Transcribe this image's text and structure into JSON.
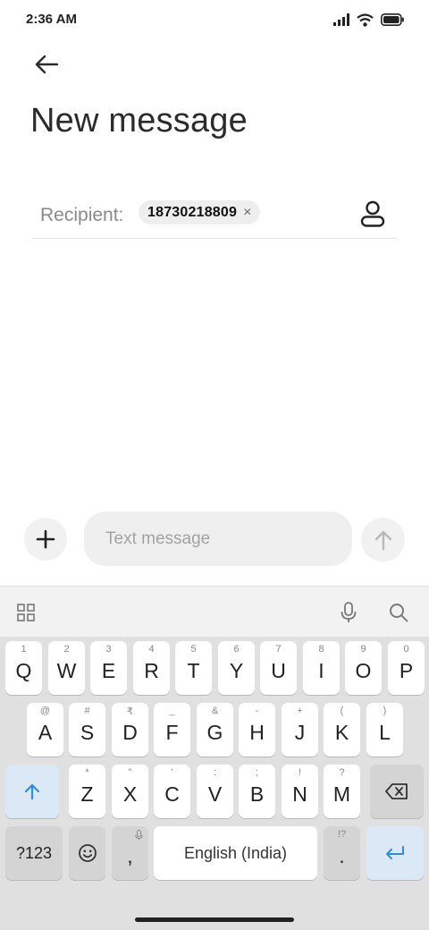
{
  "status_bar": {
    "time": "2:36 AM",
    "icons": [
      "signal-icon",
      "wifi-icon",
      "battery-icon"
    ]
  },
  "header": {
    "back_icon": "arrow-left-icon",
    "title": "New message"
  },
  "recipient": {
    "label": "Recipient:",
    "chips": [
      {
        "number": "18730218809",
        "remove_symbol": "×"
      }
    ],
    "contact_icon": "person-icon"
  },
  "compose": {
    "attach_icon": "plus-icon",
    "placeholder": "Text message",
    "value": "",
    "send_icon": "arrow-up-icon"
  },
  "keyboard": {
    "toolbar": {
      "left_icon": "grid-icon",
      "mic_icon": "microphone-icon",
      "search_icon": "search-icon"
    },
    "row1": [
      {
        "key": "Q",
        "hint": "1"
      },
      {
        "key": "W",
        "hint": "2"
      },
      {
        "key": "E",
        "hint": "3"
      },
      {
        "key": "R",
        "hint": "4"
      },
      {
        "key": "T",
        "hint": "5"
      },
      {
        "key": "Y",
        "hint": "6"
      },
      {
        "key": "U",
        "hint": "7"
      },
      {
        "key": "I",
        "hint": "8"
      },
      {
        "key": "O",
        "hint": "9"
      },
      {
        "key": "P",
        "hint": "0"
      }
    ],
    "row2": [
      {
        "key": "A",
        "hint": "@"
      },
      {
        "key": "S",
        "hint": "#"
      },
      {
        "key": "D",
        "hint": "₹"
      },
      {
        "key": "F",
        "hint": "_"
      },
      {
        "key": "G",
        "hint": "&"
      },
      {
        "key": "H",
        "hint": "-"
      },
      {
        "key": "J",
        "hint": "+"
      },
      {
        "key": "K",
        "hint": "("
      },
      {
        "key": "L",
        "hint": ")"
      }
    ],
    "row3": [
      {
        "key": "Z",
        "hint": "*"
      },
      {
        "key": "X",
        "hint": "\""
      },
      {
        "key": "C",
        "hint": "'"
      },
      {
        "key": "V",
        "hint": ":"
      },
      {
        "key": "B",
        "hint": ";"
      },
      {
        "key": "N",
        "hint": "!"
      },
      {
        "key": "M",
        "hint": "?"
      }
    ],
    "shift_icon": "shift-arrow-icon",
    "backspace_icon": "backspace-icon",
    "symbols_label": "?123",
    "emoji_icon": "emoji-icon",
    "comma": {
      "key": ",",
      "hint_icon": "microphone-icon"
    },
    "space_label": "English (India)",
    "period": {
      "key": ".",
      "hint": "!?"
    },
    "enter_icon": "enter-icon",
    "accent_color": "#2e8fd8"
  }
}
